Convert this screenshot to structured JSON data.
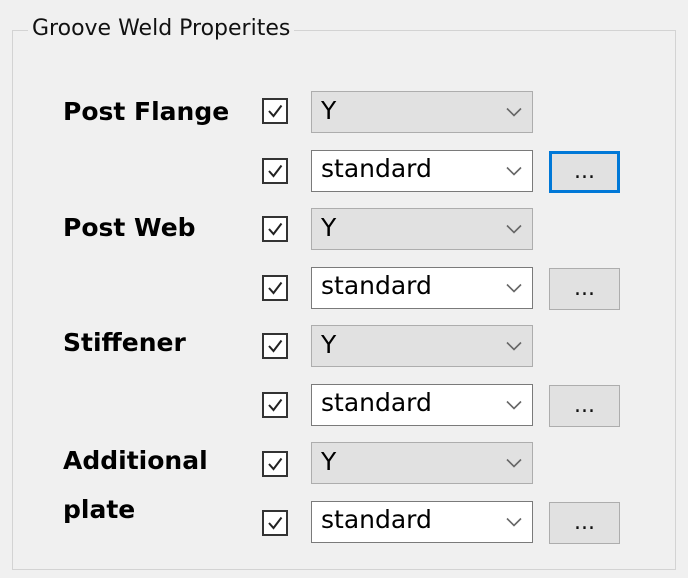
{
  "group": {
    "title": "Groove Weld Properites"
  },
  "rows": [
    {
      "label": "Post Flange",
      "type_checked": true,
      "type_value": "Y",
      "style_checked": true,
      "style_value": "standard",
      "button_label": "...",
      "button_focused": true
    },
    {
      "label": "Post Web",
      "type_checked": true,
      "type_value": "Y",
      "style_checked": true,
      "style_value": "standard",
      "button_label": "...",
      "button_focused": false
    },
    {
      "label": "Stiffener",
      "type_checked": true,
      "type_value": "Y",
      "style_checked": true,
      "style_value": "standard",
      "button_label": "...",
      "button_focused": false
    },
    {
      "label_line1": "Additional",
      "label_line2": "plate",
      "type_checked": true,
      "type_value": "Y",
      "style_checked": true,
      "style_value": "standard",
      "button_label": "...",
      "button_focused": false
    }
  ],
  "colors": {
    "focus_border": "#0078d7",
    "disabled_combo_bg": "#e1e1e1",
    "editable_combo_bg": "#ffffff"
  }
}
